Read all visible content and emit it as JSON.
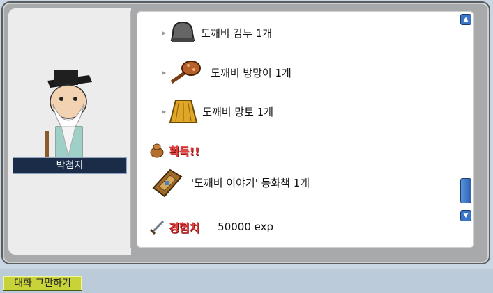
{
  "npc": {
    "name": "박첨지"
  },
  "items": [
    {
      "name": "도깨비 감투 1개",
      "icon": "helmet-icon"
    },
    {
      "name": "도깨비 방망이 1개",
      "icon": "club-icon"
    },
    {
      "name": "도깨비 망토 1개",
      "icon": "cape-icon"
    }
  ],
  "reward": {
    "label": "획득!!",
    "book": "'도깨비 이야기' 동화책 1개",
    "exp_label": "경험치",
    "exp_value": "50000 exp"
  },
  "scroll": {
    "up": "▲",
    "down": "▼"
  },
  "footer": {
    "end_button": "대화 그만하기"
  },
  "colors": {
    "reward_red": "#e53e3e",
    "scroll_blue": "#3a76c7",
    "name_bg": "#1b2c48"
  }
}
